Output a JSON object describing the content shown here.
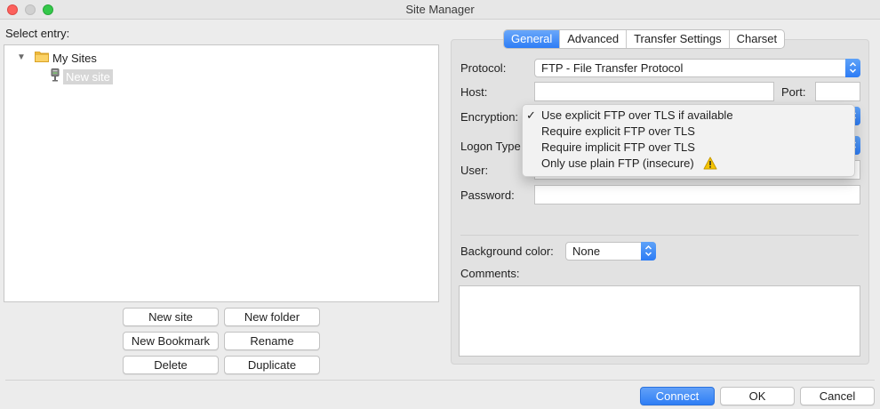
{
  "window": {
    "title": "Site Manager"
  },
  "left": {
    "select_label": "Select entry:",
    "tree": {
      "folder_label": "My Sites",
      "site_label": "New site"
    },
    "buttons": {
      "new_site": "New site",
      "new_folder": "New folder",
      "new_bookmark": "New Bookmark",
      "rename": "Rename",
      "delete": "Delete",
      "duplicate": "Duplicate"
    }
  },
  "tabs": [
    {
      "label": "General",
      "active": true
    },
    {
      "label": "Advanced",
      "active": false
    },
    {
      "label": "Transfer Settings",
      "active": false
    },
    {
      "label": "Charset",
      "active": false
    }
  ],
  "general": {
    "protocol_label": "Protocol:",
    "protocol_value": "FTP - File Transfer Protocol",
    "host_label": "Host:",
    "host_value": "",
    "port_label": "Port:",
    "port_value": "",
    "encryption_label": "Encryption:",
    "logon_type_label": "Logon Type",
    "user_label": "User:",
    "password_label": "Password:",
    "background_color_label": "Background color:",
    "background_color_value": "None",
    "comments_label": "Comments:",
    "comments_value": ""
  },
  "encryption_menu": {
    "items": [
      {
        "label": "Use explicit FTP over TLS if available",
        "checked": true
      },
      {
        "label": "Require explicit FTP over TLS",
        "checked": false
      },
      {
        "label": "Require implicit FTP over TLS",
        "checked": false
      },
      {
        "label": "Only use plain FTP (insecure)",
        "checked": false,
        "icon": "warning-icon"
      }
    ],
    "check_glyph": "✓"
  },
  "footer": {
    "connect": "Connect",
    "ok": "OK",
    "cancel": "Cancel"
  },
  "colors": {
    "accent": "#2e7df5",
    "warning": "#f5c400"
  }
}
